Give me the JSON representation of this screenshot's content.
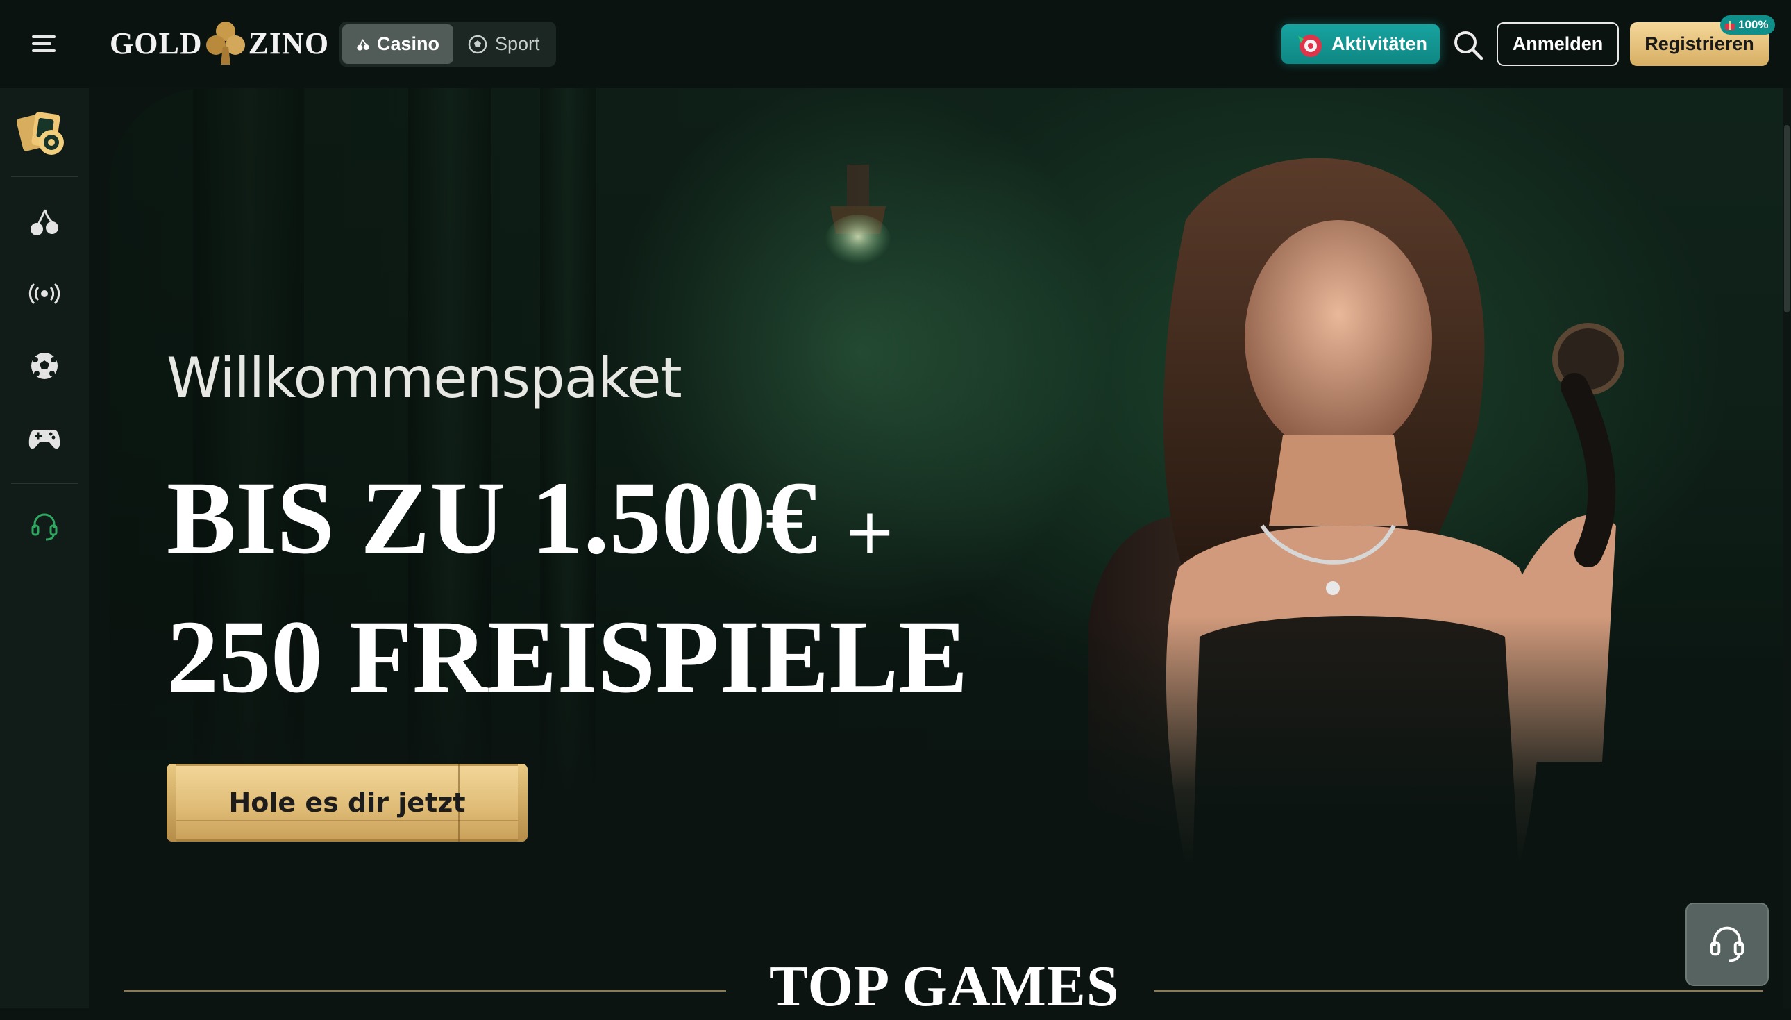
{
  "header": {
    "logo_left": "GOLD",
    "logo_right": "ZINO",
    "mode_tabs": [
      {
        "label": "Casino",
        "active": true,
        "icon": "cherry-icon"
      },
      {
        "label": "Sport",
        "active": false,
        "icon": "soccer-ball-icon"
      }
    ],
    "activities_label": "Aktivitäten",
    "login_label": "Anmelden",
    "register_label": "Registrieren",
    "register_badge": "100%"
  },
  "sidebar": {
    "items": [
      {
        "name": "casino-cards-icon",
        "active": true
      },
      {
        "name": "cherry-icon"
      },
      {
        "name": "live-broadcast-icon"
      },
      {
        "name": "soccer-ball-icon"
      },
      {
        "name": "gamepad-icon"
      },
      {
        "name": "headset-support-icon",
        "accent": "#2fa862"
      }
    ]
  },
  "hero": {
    "subtitle": "Willkommenspaket",
    "line1": "BIS ZU 1.500€",
    "plus": "+",
    "line2": "250 FREISPIELE",
    "cta_label": "Hole es dir jetzt"
  },
  "top_games": {
    "title": "TOP GAMES"
  },
  "colors": {
    "accent_teal": "#17a3a0",
    "gold": "#e0bd78",
    "background": "#0b1411"
  }
}
